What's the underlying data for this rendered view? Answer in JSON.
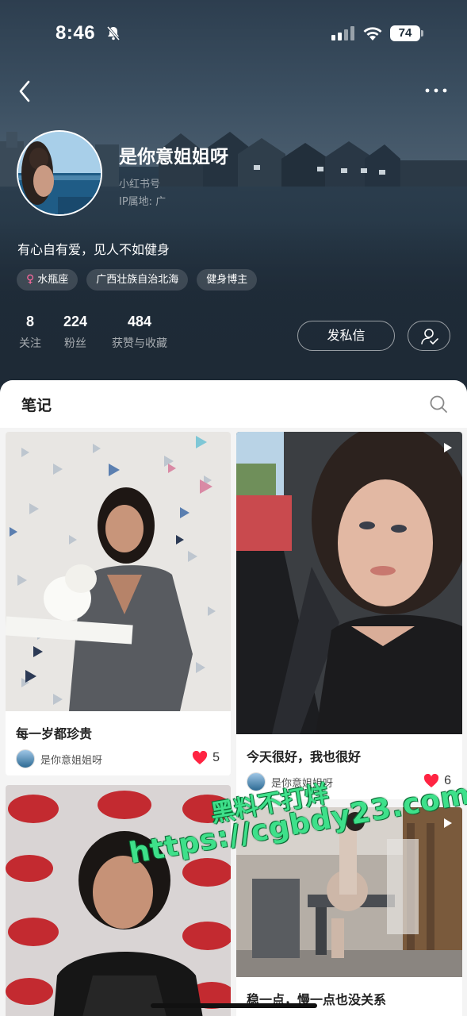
{
  "status_bar": {
    "time": "8:46",
    "battery": "74"
  },
  "profile": {
    "name": "是你意姐姐呀",
    "id_label": "小红书号",
    "ip_label": "IP属地: 广",
    "bio": "有心自有爱，见人不如健身",
    "tags": [
      "水瓶座",
      "广西壮族自治北海",
      "健身博主"
    ],
    "stats": [
      {
        "num": "8",
        "label": "关注"
      },
      {
        "num": "224",
        "label": "粉丝"
      },
      {
        "num": "484",
        "label": "获赞与收藏"
      }
    ],
    "message_button": "发私信"
  },
  "notes": {
    "section_title": "笔记",
    "cards": [
      {
        "title": "每一岁都珍贵",
        "author": "是你意姐姐呀",
        "likes": "5"
      },
      {
        "title": "今天很好，我也很好",
        "author": "是你意姐姐呀",
        "likes": "6"
      },
      {
        "title": "",
        "author": "",
        "likes": ""
      },
      {
        "title": "稳一点，慢一点也没关系",
        "author": "",
        "likes": ""
      }
    ]
  },
  "watermark": {
    "line1": "黑料不打烊",
    "line2": "https://cgbdy23.com"
  },
  "colors": {
    "header_bg": "#1e2a36",
    "like_red": "#ff2442",
    "watermark_green": "#3ee08a"
  }
}
